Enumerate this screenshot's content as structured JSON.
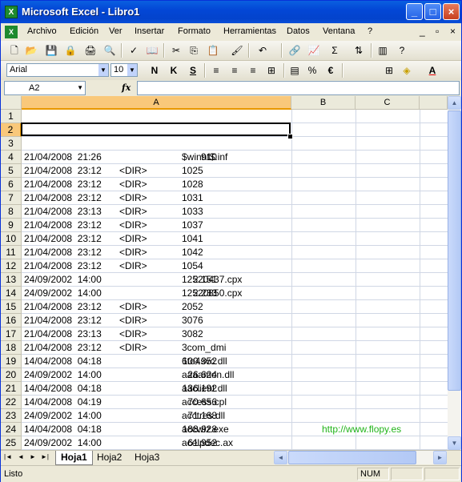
{
  "window": {
    "title": "Microsoft Excel - Libro1",
    "app_icon": "X",
    "minimize": "_",
    "maximize": "□",
    "close": "×"
  },
  "menu": {
    "doc_icon": "X",
    "items": [
      "Archivo",
      "Edición",
      "Ver",
      "Insertar",
      "Formato",
      "Herramientas",
      "Datos",
      "Ventana",
      "?"
    ],
    "controls": [
      "_",
      "▫",
      "×"
    ]
  },
  "toolbar_standard": {
    "icons": [
      "new-icon",
      "open-icon",
      "save-icon",
      "permission-icon",
      "print-icon",
      "print-preview-icon",
      "spelling-icon",
      "research-icon",
      "cut-icon",
      "copy-icon",
      "paste-icon",
      "format-painter-icon",
      "undo-icon",
      "insert-hyperlink-icon",
      "chart-wizard-icon",
      "autosum-icon",
      "sort-ascending-icon",
      "chart-icon",
      "help-icon"
    ],
    "glyphs": [
      "🗋",
      "📂",
      "💾",
      "🔒",
      "🖨",
      "🔍",
      "✓",
      "📖",
      "✂",
      "⎘",
      "📋",
      "🖌",
      "↶",
      "🔗",
      "📈",
      "Σ",
      "⇅",
      "▥",
      "?"
    ]
  },
  "toolbar_format": {
    "font": "Arial",
    "size": "10",
    "bold": "N",
    "italic": "K",
    "underline": "S",
    "align_icons": [
      "align-left-icon",
      "align-center-icon",
      "align-right-icon",
      "merge-center-icon"
    ],
    "align_glyphs": [
      "≡",
      "≡",
      "≡",
      "⊞"
    ],
    "percent": "%",
    "currency": "€",
    "borders_glyph": "⊞",
    "fill_glyph": "◈",
    "font_color_glyph": "A"
  },
  "formula_bar": {
    "name_box": "A2",
    "fx": "fx",
    "value": ""
  },
  "columns": [
    "A",
    "B",
    "C"
  ],
  "rows": [
    {
      "n": "1"
    },
    {
      "n": "2"
    },
    {
      "n": "3"
    },
    {
      "n": "4",
      "dt": "21/04/2008  21:26",
      "dir": "",
      "size": "910",
      "name": "$winnt$.inf"
    },
    {
      "n": "5",
      "dt": "21/04/2008  23:12",
      "dir": "<DIR>",
      "size": "",
      "name": "1025"
    },
    {
      "n": "6",
      "dt": "21/04/2008  23:12",
      "dir": "<DIR>",
      "size": "",
      "name": "1028"
    },
    {
      "n": "7",
      "dt": "21/04/2008  23:12",
      "dir": "<DIR>",
      "size": "",
      "name": "1031"
    },
    {
      "n": "8",
      "dt": "21/04/2008  23:13",
      "dir": "<DIR>",
      "size": "",
      "name": "1033"
    },
    {
      "n": "9",
      "dt": "21/04/2008  23:12",
      "dir": "<DIR>",
      "size": "",
      "name": "1037"
    },
    {
      "n": "10",
      "dt": "21/04/2008  23:12",
      "dir": "<DIR>",
      "size": "",
      "name": "1041"
    },
    {
      "n": "11",
      "dt": "21/04/2008  23:12",
      "dir": "<DIR>",
      "size": "",
      "name": "1042"
    },
    {
      "n": "12",
      "dt": "21/04/2008  23:12",
      "dir": "<DIR>",
      "size": "",
      "name": "1054"
    },
    {
      "n": "13",
      "dt": "24/09/2002  14:00",
      "dir": "",
      "size": "2.151",
      "name": "12520437.cpx"
    },
    {
      "n": "14",
      "dt": "24/09/2002  14:00",
      "dir": "",
      "size": "2.233",
      "name": "12520850.cpx"
    },
    {
      "n": "15",
      "dt": "21/04/2008  23:12",
      "dir": "<DIR>",
      "size": "",
      "name": "2052"
    },
    {
      "n": "16",
      "dt": "21/04/2008  23:12",
      "dir": "<DIR>",
      "size": "",
      "name": "3076"
    },
    {
      "n": "17",
      "dt": "21/04/2008  23:13",
      "dir": "<DIR>",
      "size": "",
      "name": "3082"
    },
    {
      "n": "18",
      "dt": "21/04/2008  23:12",
      "dir": "<DIR>",
      "size": "",
      "name": "3com_dmi"
    },
    {
      "n": "19",
      "dt": "14/04/2008  04:18",
      "dir": "",
      "size": "100.352",
      "name": "6to4svc.dll"
    },
    {
      "n": "20",
      "dt": "24/09/2002  14:00",
      "dir": "",
      "size": "26.624",
      "name": "aaaamon.dll"
    },
    {
      "n": "21",
      "dt": "14/04/2008  04:18",
      "dir": "",
      "size": "136.192",
      "name": "aaclient.dll"
    },
    {
      "n": "22",
      "dt": "14/04/2008  04:19",
      "dir": "",
      "size": "70.656",
      "name": "access.cpl"
    },
    {
      "n": "23",
      "dt": "24/09/2002  14:00",
      "dir": "",
      "size": "71.168",
      "name": "acctres.dll"
    },
    {
      "n": "24",
      "dt": "14/04/2008  04:18",
      "dir": "",
      "size": "188.928",
      "name": "accwiz.exe"
    },
    {
      "n": "25",
      "dt": "24/09/2002  14:00",
      "dir": "",
      "size": "61.952",
      "name": "acelpdec.ax"
    }
  ],
  "watermark_url": "http://www.flopy.es",
  "sheets": {
    "nav": [
      "|◄",
      "◄",
      "►",
      "►|"
    ],
    "tabs": [
      "Hoja1",
      "Hoja2",
      "Hoja3"
    ],
    "active": "Hoja1"
  },
  "status": {
    "text": "Listo",
    "num": "NUM"
  },
  "colors": {
    "title_bar": "#0347D6",
    "selected_header": "#F9C87A",
    "link_green": "#22B41A"
  }
}
